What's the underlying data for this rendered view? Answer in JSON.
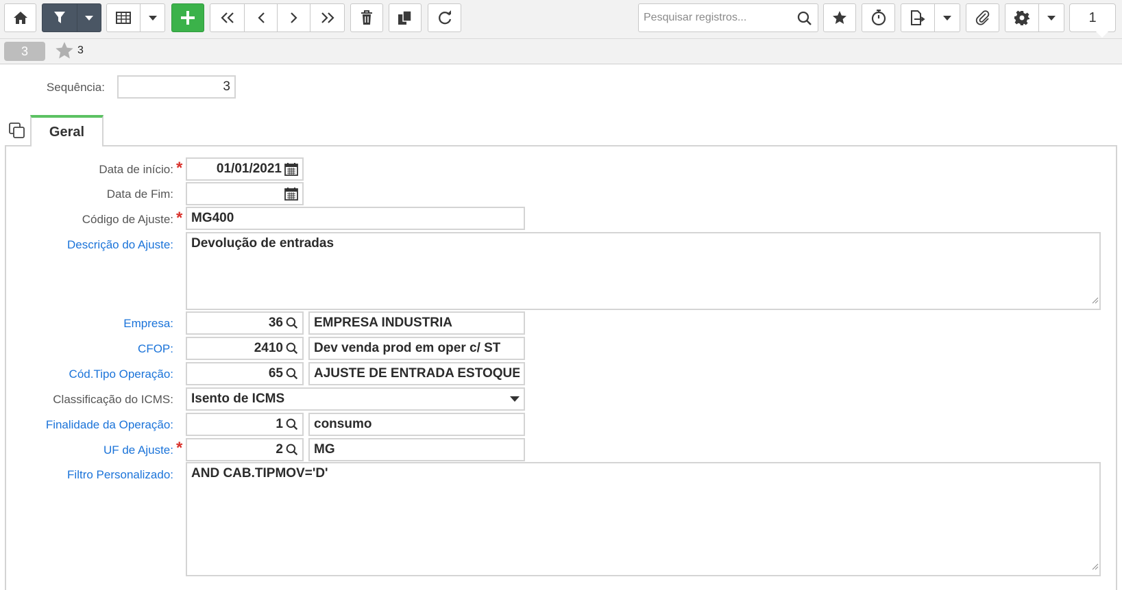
{
  "toolbar": {
    "search_placeholder": "Pesquisar registros...",
    "page_number": "1",
    "icons": [
      "home-icon",
      "filter-icon",
      "chevron-down-icon",
      "grid-icon",
      "plus-icon",
      "first-icon",
      "prev-icon",
      "next-icon",
      "last-icon",
      "trash-icon",
      "copy-icon",
      "refresh-icon",
      "search-icon",
      "star-icon",
      "timer-icon",
      "export-icon",
      "attach-icon",
      "gear-icon"
    ]
  },
  "record": {
    "badge": "3",
    "favorites_count": "3"
  },
  "sequencia": {
    "label": "Sequência:",
    "value": "3"
  },
  "tabs": [
    {
      "label": "Geral",
      "active": true
    }
  ],
  "form": {
    "data_inicio": {
      "label": "Data de início:",
      "value": "01/01/2021",
      "required": true
    },
    "data_fim": {
      "label": "Data de Fim:",
      "value": ""
    },
    "codigo_ajuste": {
      "label": "Código de Ajuste:",
      "value": "MG400",
      "required": true
    },
    "descricao_ajuste": {
      "label": "Descrição do Ajuste:",
      "value": "Devolução de entradas"
    },
    "empresa": {
      "label": "Empresa:",
      "code": "36",
      "desc": "EMPRESA INDUSTRIA"
    },
    "cfop": {
      "label": "CFOP:",
      "code": "2410",
      "desc": "Dev venda prod em oper c/ ST"
    },
    "tipo_operacao": {
      "label": "Cód.Tipo Operação:",
      "code": "65",
      "desc": "AJUSTE DE ENTRADA ESTOQUE"
    },
    "classificacao_icms": {
      "label": "Classificação do ICMS:",
      "value": "Isento de ICMS"
    },
    "finalidade_operacao": {
      "label": "Finalidade da Operação:",
      "code": "1",
      "desc": "consumo"
    },
    "uf_ajuste": {
      "label": "UF de Ajuste:",
      "code": "2",
      "desc": "MG",
      "required": true
    },
    "filtro_personalizado": {
      "label": "Filtro Personalizado:",
      "value": "AND CAB.TIPMOV='D'"
    }
  },
  "colors": {
    "accent_green": "#3bb24a",
    "link_blue": "#1a73d9",
    "required_red": "#d9322c",
    "dark_button": "#4a5664"
  }
}
